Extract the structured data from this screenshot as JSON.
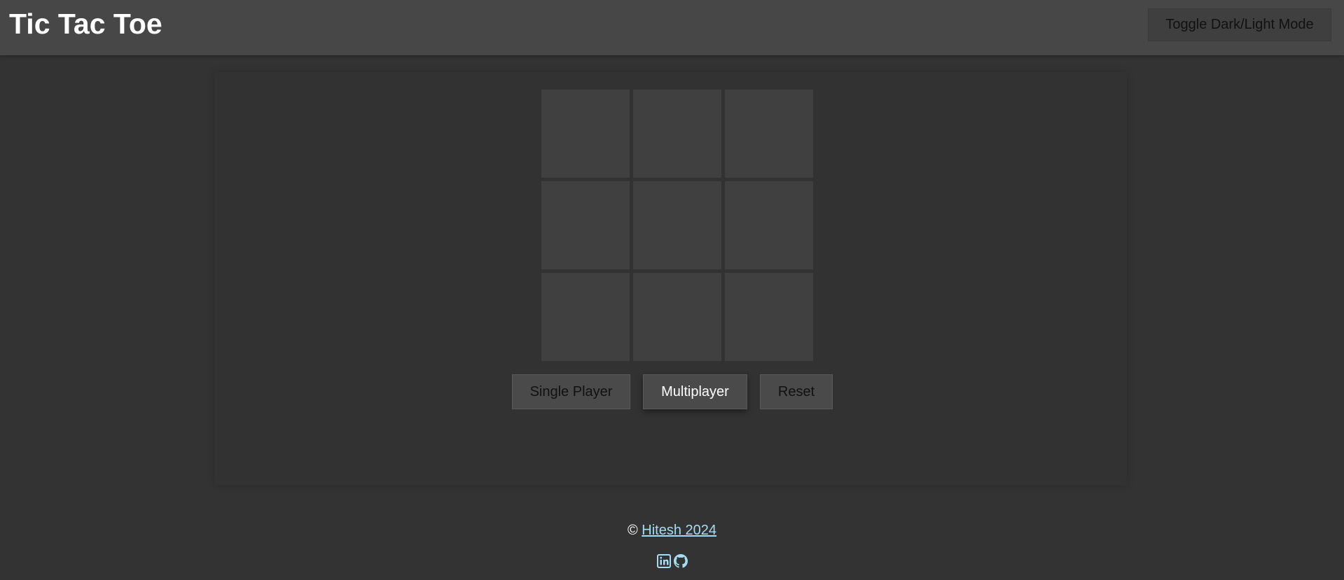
{
  "header": {
    "title": "Tic Tac Toe",
    "toggle_label": "Toggle Dark/Light Mode"
  },
  "board": {
    "cells": [
      "",
      "",
      "",
      "",
      "",
      "",
      "",
      "",
      ""
    ]
  },
  "controls": {
    "single_player_label": "Single Player",
    "multiplayer_label": "Multiplayer",
    "reset_label": "Reset"
  },
  "footer": {
    "copyright_symbol": "©",
    "author_link_text": "Hitesh 2024",
    "social_icons": [
      "linkedin-icon",
      "github-icon"
    ]
  },
  "colors": {
    "background": "#333333",
    "header_bg": "#474747",
    "cell_bg": "#404040",
    "link": "#a6dcf2"
  }
}
